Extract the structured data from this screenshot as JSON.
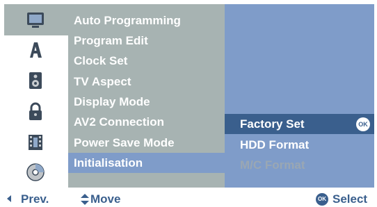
{
  "colors": {
    "panel_blue": "#7f9cc9",
    "item_gray": "#a7b3b2",
    "highlight_dark": "#3a5f8d",
    "text_white": "#ffffff",
    "disabled_text": "#9aa7b3"
  },
  "sidebar": {
    "icons": [
      {
        "name": "picture-icon",
        "selected": true
      },
      {
        "name": "language-icon",
        "selected": false
      },
      {
        "name": "audio-icon",
        "selected": false
      },
      {
        "name": "lock-icon",
        "selected": false
      },
      {
        "name": "recording-icon",
        "selected": false
      },
      {
        "name": "disc-icon",
        "selected": false
      }
    ]
  },
  "menu": {
    "items": [
      {
        "label": "Auto Programming"
      },
      {
        "label": "Program Edit"
      },
      {
        "label": "Clock Set"
      },
      {
        "label": "TV Aspect"
      },
      {
        "label": "Display Mode"
      },
      {
        "label": "AV2 Connection"
      },
      {
        "label": "Power Save Mode"
      },
      {
        "label": "Initialisation",
        "selected": true
      }
    ]
  },
  "submenu": {
    "items": [
      {
        "label": "Factory Set",
        "highlighted": true,
        "ok_badge": "OK"
      },
      {
        "label": "HDD Format"
      },
      {
        "label": "M/C Format",
        "disabled": true
      }
    ]
  },
  "footer": {
    "prev_label": "Prev.",
    "move_label": "Move",
    "ok_label": "OK",
    "select_label": "Select"
  }
}
